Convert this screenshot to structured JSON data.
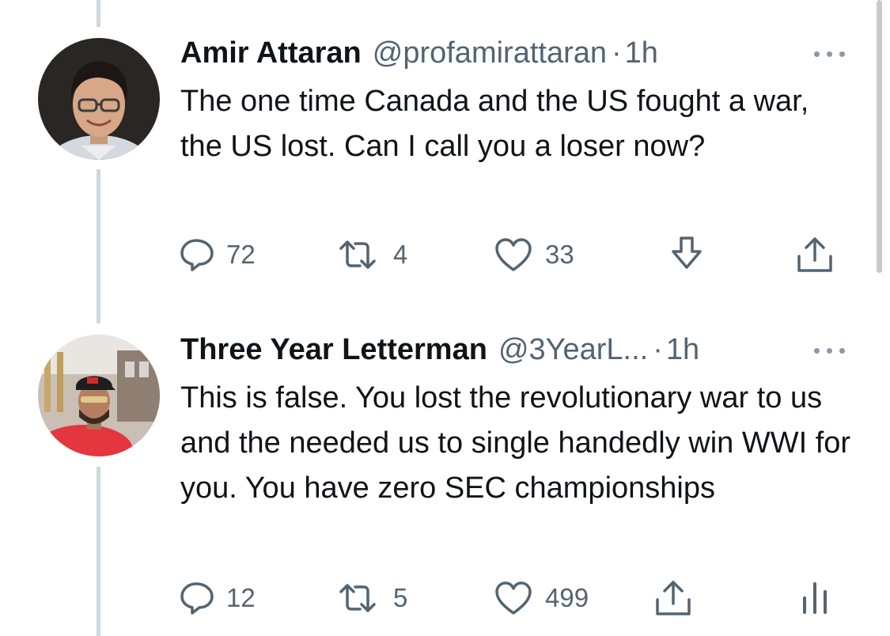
{
  "tweets": [
    {
      "name": "Amir Attaran",
      "handle": "@profamirattaran",
      "separator": "·",
      "time": "1h",
      "text": "The one time Canada and the US fought a war, the US lost.  Can I call you a loser now?",
      "actions": {
        "replies": "72",
        "retweets": "4",
        "likes": "33"
      },
      "icons": [
        "reply-icon",
        "retweet-icon",
        "like-icon",
        "download-icon",
        "share-icon"
      ]
    },
    {
      "name": "Three Year Letterman",
      "handle": "@3YearL...",
      "separator": "·",
      "time": "1h",
      "text": "This is false. You lost the revolutionary war to us and the needed us to single handedly win WWI for you. You have zero SEC championships",
      "actions": {
        "replies": "12",
        "retweets": "5",
        "likes": "499"
      },
      "icons": [
        "reply-icon",
        "retweet-icon",
        "like-icon",
        "share-icon",
        "analytics-icon"
      ]
    }
  ],
  "colors": {
    "text": "#0f1419",
    "secondary": "#536471",
    "thread_line": "#cfd9de"
  }
}
